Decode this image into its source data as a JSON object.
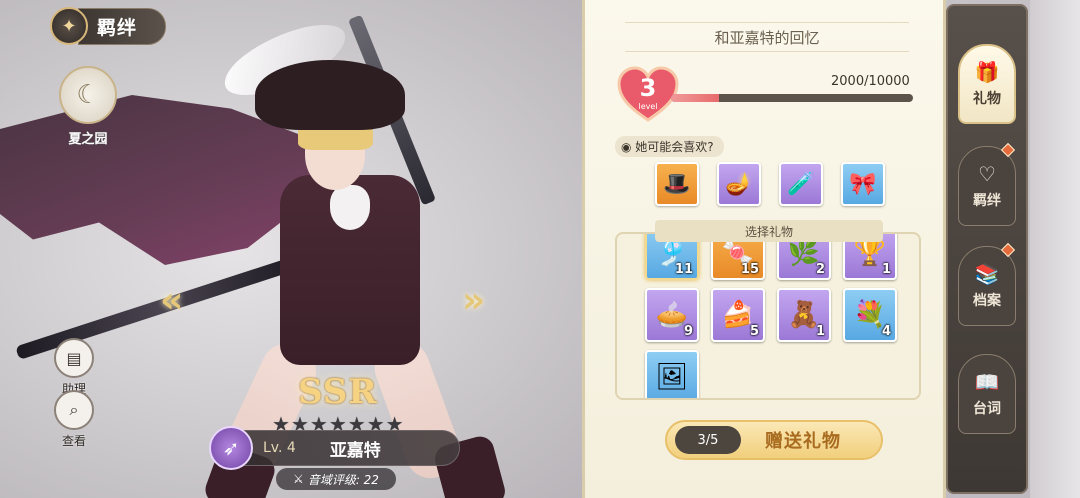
{
  "header": {
    "title": "羁绊",
    "icon": "bond-knot-icon"
  },
  "faction": {
    "label": "夏之园",
    "icon": "moon-crest-icon"
  },
  "side_buttons": [
    {
      "label": "助理",
      "icon": "assistant-icon"
    },
    {
      "label": "查看",
      "icon": "magnifier-icon"
    }
  ],
  "character": {
    "rarity": "SSR",
    "stars_total": 7,
    "level": "Lv. 4",
    "name": "亚嘉特",
    "rating": "音域评级: 22",
    "class_icon": "bow-class-icon"
  },
  "memory": {
    "title": "和亚嘉特的回忆",
    "level": "3",
    "level_sub": "level",
    "exp_text": "2000/10000",
    "exp_current": 2000,
    "exp_max": 10000
  },
  "preferences": {
    "hint": "她可能会喜欢?",
    "items": [
      {
        "name": "hat-gift-icon",
        "rarity": "orange",
        "glyph": "🎩"
      },
      {
        "name": "lamp-gift-icon",
        "rarity": "purple",
        "glyph": "🪔"
      },
      {
        "name": "potion-gift-icon",
        "rarity": "purple",
        "glyph": "🧪"
      },
      {
        "name": "ribbon-gift-icon",
        "rarity": "blue",
        "glyph": "🎀"
      }
    ]
  },
  "inventory": {
    "title": "选择礼物",
    "items": [
      {
        "name": "gift-item-1",
        "count": "11",
        "rarity": "blue",
        "glyph": "🎐"
      },
      {
        "name": "gift-item-2",
        "count": "15",
        "rarity": "orange",
        "glyph": "🍬"
      },
      {
        "name": "gift-item-3",
        "count": "2",
        "rarity": "purple",
        "glyph": "🌿"
      },
      {
        "name": "gift-item-4",
        "count": "1",
        "rarity": "purple",
        "glyph": "🏆"
      },
      {
        "name": "gift-item-pie",
        "count": "9",
        "rarity": "purple",
        "glyph": "🥧"
      },
      {
        "name": "gift-item-cake",
        "count": "5",
        "rarity": "purple",
        "glyph": "🍰"
      },
      {
        "name": "gift-item-doll",
        "count": "1",
        "rarity": "purple",
        "glyph": "🧸"
      },
      {
        "name": "gift-item-flowers",
        "count": "4",
        "rarity": "blue",
        "glyph": "💐"
      },
      {
        "name": "gift-item-painting",
        "count": "",
        "rarity": "blue",
        "glyph": "🖼"
      }
    ]
  },
  "give": {
    "count": "3/5",
    "label": "赠送礼物"
  },
  "tabs": [
    {
      "label": "礼物",
      "icon": "gift-box-icon",
      "glyph": "🎁",
      "active": true,
      "dot": false
    },
    {
      "label": "羁绊",
      "icon": "heart-link-icon",
      "glyph": "♡",
      "active": false,
      "dot": true
    },
    {
      "label": "档案",
      "icon": "books-icon",
      "glyph": "📚",
      "active": false,
      "dot": true
    },
    {
      "label": "台词",
      "icon": "book-open-icon",
      "glyph": "📖",
      "active": false,
      "dot": false
    }
  ],
  "colors": {
    "accent_gold": "#f1cf7c",
    "heart_red": "#e95b6a",
    "rarity_orange": "#e88a27",
    "rarity_purple": "#9b78d6",
    "rarity_blue": "#57a8e2"
  }
}
